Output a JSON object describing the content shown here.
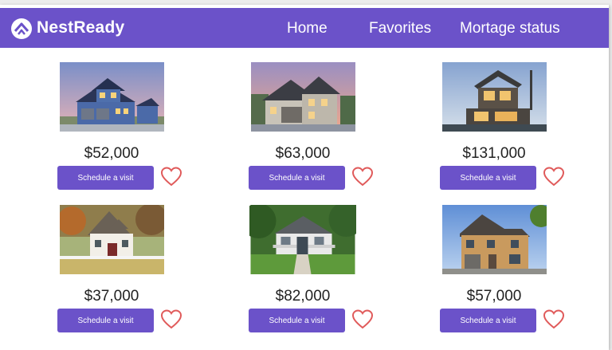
{
  "brand": "NestReady",
  "nav": [
    "Home",
    "Favorites",
    "Mortage status"
  ],
  "accent": "#6b52c9",
  "heart_color": "#e05a5a",
  "listings": [
    {
      "price": "$52,000",
      "button": "Schedule a visit"
    },
    {
      "price": "$63,000",
      "button": "Schedule a visit"
    },
    {
      "price": "$131,000",
      "button": "Schedule a visit"
    },
    {
      "price": "$37,000",
      "button": "Schedule a visit"
    },
    {
      "price": "$82,000",
      "button": "Schedule a visit"
    },
    {
      "price": "$57,000",
      "button": "Schedule a visit"
    }
  ]
}
